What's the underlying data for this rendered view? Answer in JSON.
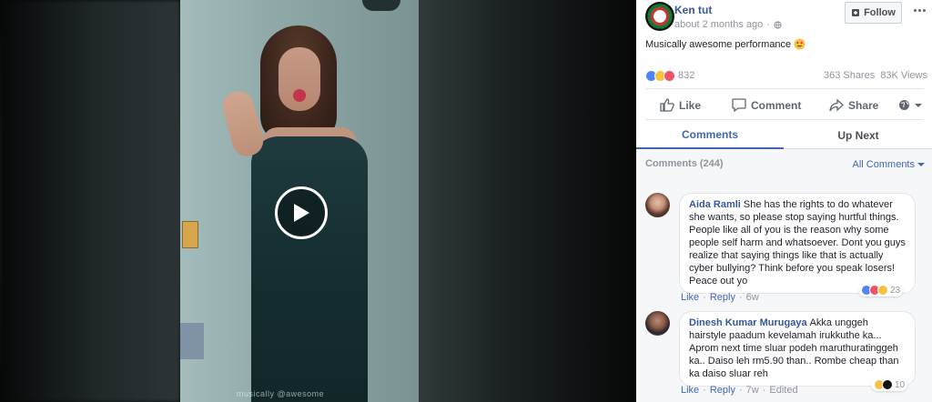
{
  "post": {
    "page_name": "Ken tut",
    "time": "about 2 months ago",
    "follow_label": "Follow",
    "text": "Musically awesome performance",
    "reaction_count": "832",
    "shares": "363 Shares",
    "views": "83K Views"
  },
  "actions": {
    "like": "Like",
    "comment": "Comment",
    "share": "Share"
  },
  "tabs": [
    {
      "label": "Comments",
      "active": true
    },
    {
      "label": "Up Next",
      "active": false
    }
  ],
  "comments_section": {
    "header": "Comments (244)",
    "filter_label": "All Comments"
  },
  "comments": [
    {
      "author": "Aida Ramli",
      "text": "She has the rights to do whatever she wants, so please stop saying hurtful things. People like all of you is the reason why some people self harm and whatsoever. Dont you guys realize that saying things like that is actually cyber bullying? Think before you speak losers! Peace out yo",
      "like_label": "Like",
      "reply_label": "Reply",
      "time": "6w",
      "reaction_count": "23"
    },
    {
      "author": "Dinesh Kumar Murugaya",
      "text": "Akka unggeh hairstyle paadum kevelamah irukkuthe ka... Aprom next time sluar podeh maruthuratinggeh ka.. Daiso leh rm5.90 than.. Rombe cheap than ka daiso sluar reh",
      "like_label": "Like",
      "reply_label": "Reply",
      "time": "7w",
      "edited": "Edited",
      "reaction_count": "10"
    }
  ],
  "video": {
    "watermark": "musically @awesome"
  },
  "colors": {
    "link": "#365899",
    "accent": "#4267b2",
    "muted": "#90949c"
  }
}
